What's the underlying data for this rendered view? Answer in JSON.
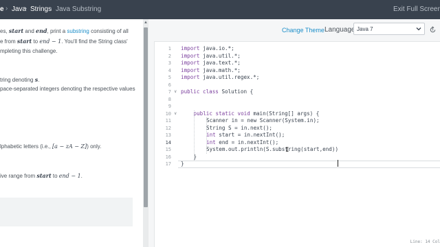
{
  "breadcrumb": {
    "items": [
      {
        "label": "e"
      },
      {
        "label": "Java"
      },
      {
        "label": "Strings"
      },
      {
        "label": "Java Substring"
      }
    ],
    "separator": "›",
    "exit_label": "Exit Full Screen View"
  },
  "problem": {
    "line1": {
      "pre": "es, ",
      "start": "start",
      "mid": " and ",
      "end": "end",
      "post": ", print a ",
      "link": "substring",
      "tail": " consisting of all"
    },
    "line2": {
      "pre": "e from ",
      "start": "start",
      "mid": " to ",
      "expr": "end − 1",
      "post": ". You'll find the String class'"
    },
    "line3": "mpleting this challenge.",
    "line4": {
      "pre": "tring denoting ",
      "var": "s",
      "post": "."
    },
    "line5": "pace-separated integers denoting the respective values",
    "line6": {
      "pre": "lphabetic letters (i.e., ",
      "expr": "[a − zA − Z]",
      "post": ") only."
    },
    "line7": {
      "pre": "ive range from ",
      "start": "start",
      "mid": " to ",
      "expr": "end − 1",
      "post": "."
    }
  },
  "toolbar": {
    "change_theme": "Change Theme",
    "language_label": "Language",
    "language_value": "Java 7"
  },
  "icons": {
    "dropdown": "chevron-down-icon",
    "reset": "reset-icon"
  },
  "editor": {
    "active_line": 14,
    "status": "Line: 14 Col",
    "lines": [
      {
        "n": "1",
        "kw": "import",
        "rest": " java.io.*;",
        "indent": 0
      },
      {
        "n": "2",
        "kw": "import",
        "rest": " java.util.*;",
        "indent": 0
      },
      {
        "n": "3",
        "kw": "import",
        "rest": " java.text.*;",
        "indent": 0
      },
      {
        "n": "4",
        "kw": "import",
        "rest": " java.math.*;",
        "indent": 0
      },
      {
        "n": "5",
        "kw": "import",
        "rest": " java.util.regex.*;",
        "indent": 0
      },
      {
        "n": "6",
        "kw": "",
        "rest": "",
        "indent": 0
      },
      {
        "n": "7",
        "kw": "public class",
        "rest": " Solution {",
        "indent": 0
      },
      {
        "n": "8",
        "kw": "",
        "rest": "",
        "indent": 0
      },
      {
        "n": "9",
        "kw": "",
        "rest": "",
        "indent": 0
      },
      {
        "n": "10",
        "kw": "public static void",
        "rest": " main(String[] args) {",
        "indent": 1
      },
      {
        "n": "11",
        "kw": "",
        "rest": "Scanner in = new Scanner(System.in);",
        "indent": 2
      },
      {
        "n": "12",
        "kw": "",
        "rest": "String S = in.next();",
        "indent": 2
      },
      {
        "n": "13",
        "kw": "int",
        "rest": " start = in.nextInt();",
        "indent": 2
      },
      {
        "n": "14",
        "kw": "int",
        "rest": " end = in.nextInt();",
        "indent": 2
      },
      {
        "n": "15",
        "kw": "",
        "rest": "System.out.println(S.substring(start,end))",
        "indent": 2
      },
      {
        "n": "16",
        "kw": "",
        "rest": "}",
        "indent": 1
      },
      {
        "n": "17",
        "kw": "",
        "rest": "}",
        "indent": 0
      }
    ]
  },
  "colors": {
    "topbar": "#39424e",
    "link": "#1b8ec9",
    "keyword": "#7a3e9d"
  }
}
